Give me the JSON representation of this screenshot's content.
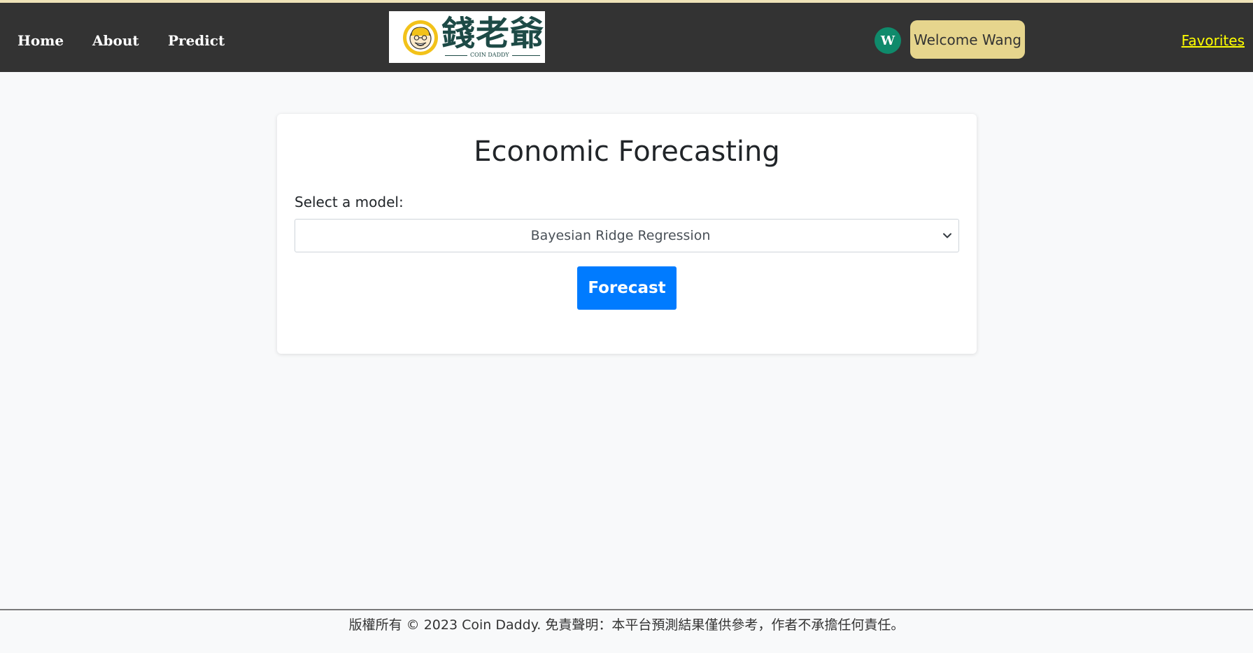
{
  "nav": {
    "home": "Home",
    "about": "About",
    "predict": "Predict",
    "logo_text": "錢老爺",
    "logo_sub": "COIN DADDY",
    "avatar_initial": "W",
    "welcome": "Welcome Wang",
    "favorites": "Favorites"
  },
  "card": {
    "title": "Economic Forecasting",
    "model_label": "Select a model:",
    "selected_model": "Bayesian Ridge Regression",
    "forecast_button": "Forecast"
  },
  "footer": {
    "text": "版權所有 © 2023 Coin Daddy. 免責聲明：本平台預測結果僅供參考，作者不承擔任何責任。"
  },
  "colors": {
    "navbar": "#333333",
    "welcome_bg": "#e6d58d",
    "favorites": "#ffff00",
    "avatar": "#0f8a6b",
    "primary": "#007bff",
    "logo_text": "#1d4a46",
    "logo_gold": "#f2c21a"
  }
}
